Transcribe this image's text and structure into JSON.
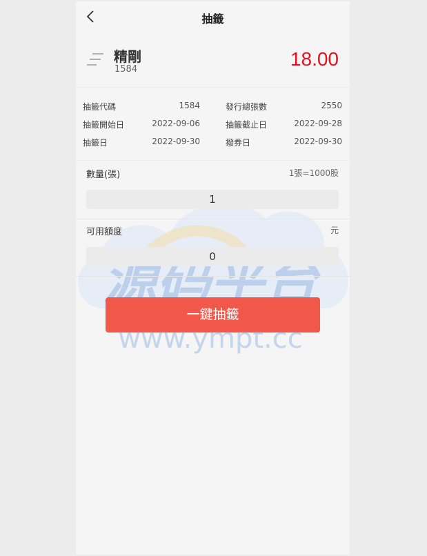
{
  "header": {
    "title": "抽籤",
    "back_icon": "chevron-left-icon"
  },
  "stock": {
    "name": "精剛",
    "code": "1584",
    "price": "18.00",
    "price_color": "#e8101c",
    "icon": "menu-lines-icon"
  },
  "info": [
    {
      "k1": "抽籤代碼",
      "v1": "1584",
      "k2": "發行總張數",
      "v2": "2550"
    },
    {
      "k1": "抽籤開始日",
      "v1": "2022-09-06",
      "k2": "抽籤截止日",
      "v2": "2022-09-28"
    },
    {
      "k1": "抽籤日",
      "v1": "2022-09-30",
      "k2": "撥券日",
      "v2": "2022-09-30"
    }
  ],
  "quantity": {
    "label": "數量(張)",
    "note": "1張=1000股",
    "value": "1"
  },
  "available": {
    "label": "可用額度",
    "unit": "元",
    "value": "0"
  },
  "submit": {
    "label": "一鍵抽籤",
    "color": "#f2584a"
  },
  "watermark": {
    "text": "源码平台",
    "url": "www.ympt.cc"
  }
}
